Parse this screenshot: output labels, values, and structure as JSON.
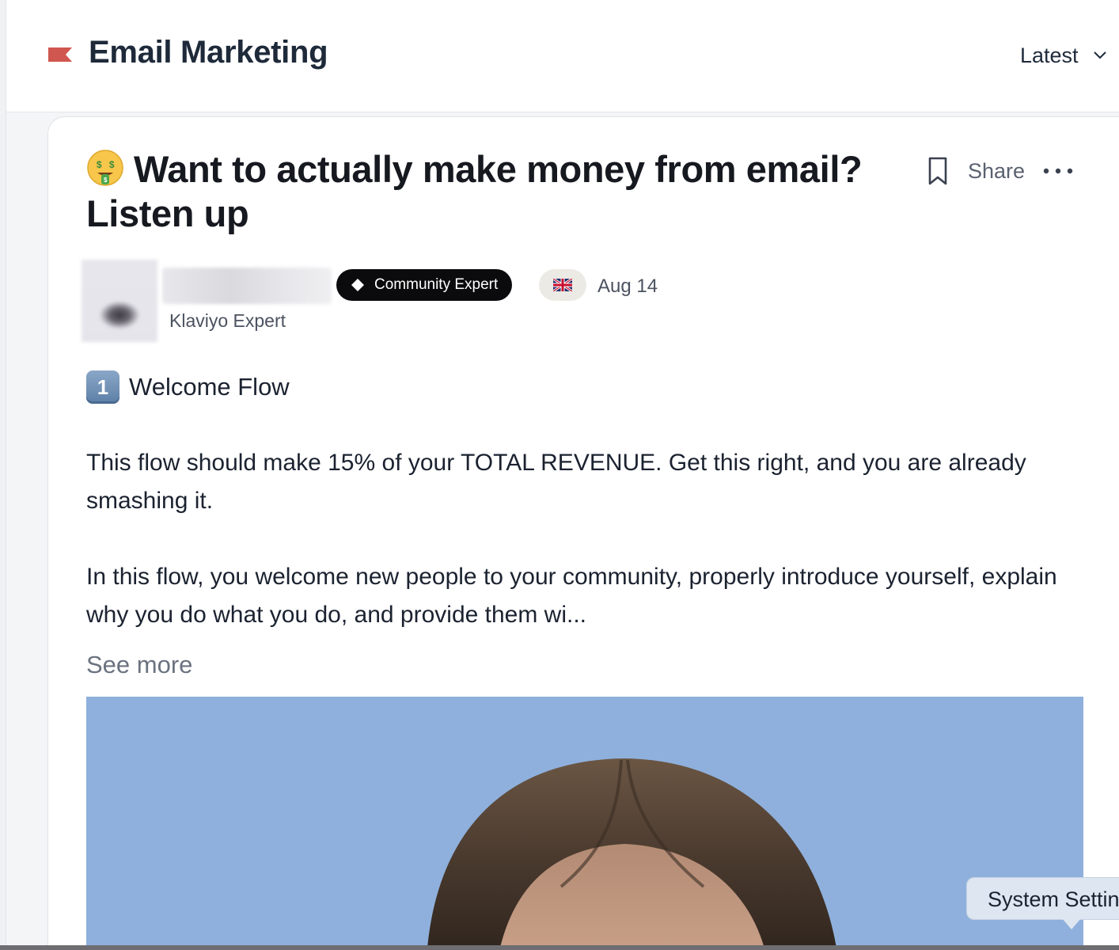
{
  "header": {
    "title": "Email Marketing",
    "sort": {
      "selected": "Latest"
    }
  },
  "post": {
    "title": "Want to actually make money from email? Listen up",
    "title_emoji": "money-mouth-face",
    "actions": {
      "share_label": "Share"
    },
    "author": {
      "badge": "Community Expert",
      "role": "Klaviyo Expert",
      "flag": "united-kingdom",
      "date": "Aug 14"
    },
    "section_heading": "Welcome Flow",
    "section_number": "1",
    "paragraphs": [
      "This flow should make 15% of your TOTAL REVENUE. Get this right, and you are already smashing it.",
      "In this flow, you welcome new people to your community, properly introduce yourself, explain why you do what you do, and provide them wi..."
    ],
    "see_more": "See more"
  },
  "tooltip": {
    "text": "System Settings"
  },
  "colors": {
    "accent_flag": "#d0574f",
    "badge_bg": "#0b0b0d",
    "image_bg": "#8fb0dc"
  }
}
